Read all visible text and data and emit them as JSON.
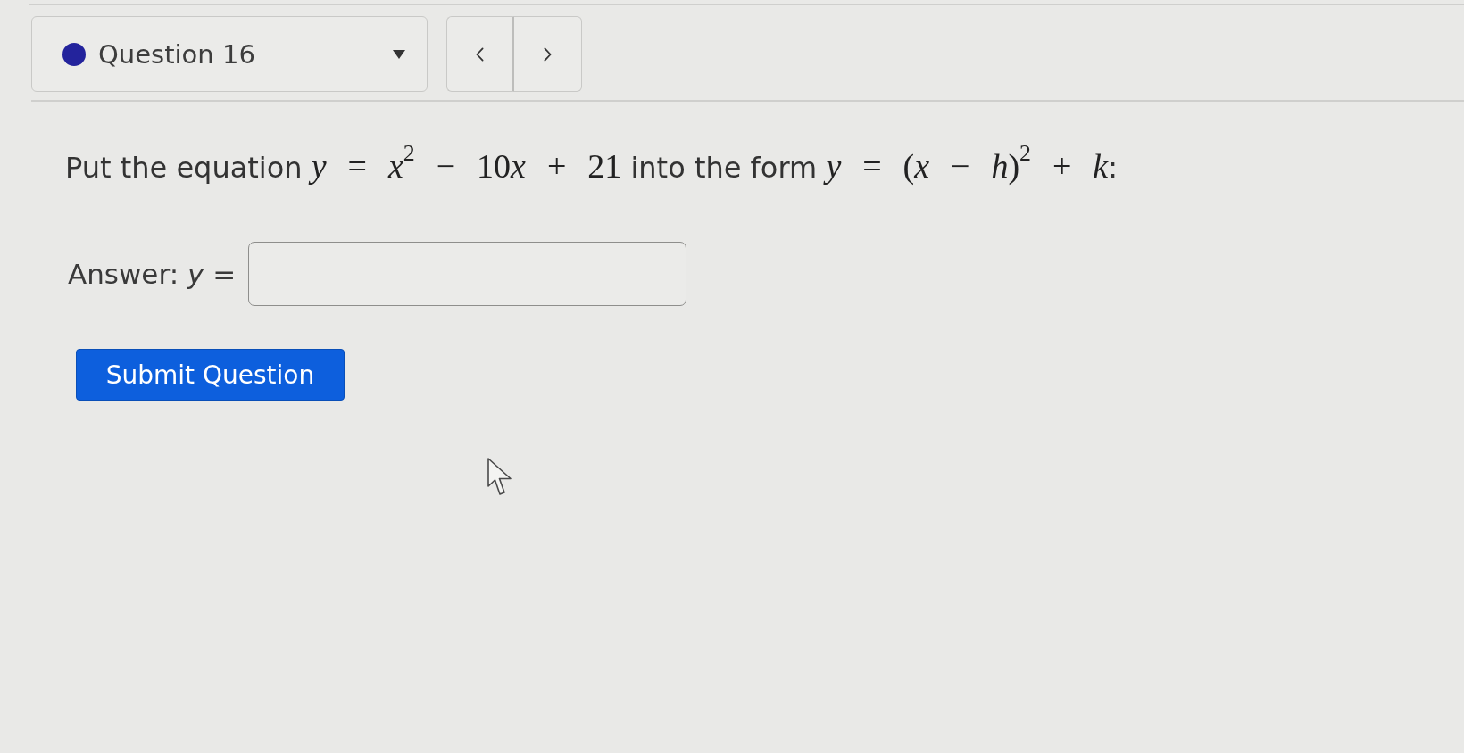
{
  "question_selector": {
    "label": "Question 16"
  },
  "prompt": [
    {
      "kind": "text",
      "text": "Put the equation "
    },
    {
      "kind": "math",
      "text": "*y* = *x*$^{2}$ − 10"
    },
    {
      "kind": "math",
      "text": "*x* + 21"
    },
    {
      "kind": "text",
      "text": " into the form "
    },
    {
      "kind": "math",
      "text": "*y* = (*x* − *h*)$^{2}$ + *k*"
    },
    {
      "kind": "text",
      "text": ":"
    }
  ],
  "answer": {
    "label": "Answer: *y* ="
  },
  "submit_button": {
    "label": "Submit Question"
  }
}
